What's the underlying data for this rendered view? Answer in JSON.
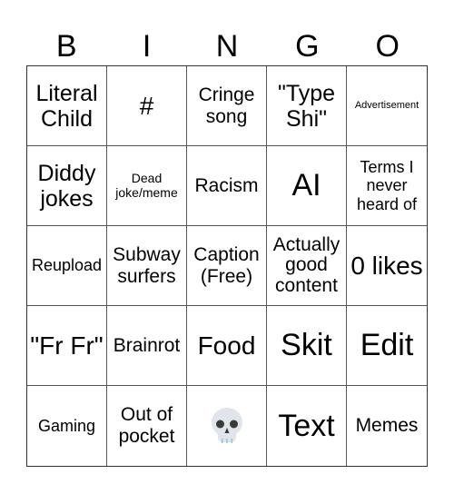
{
  "header": {
    "letters": [
      "B",
      "I",
      "N",
      "G",
      "O"
    ]
  },
  "cells": [
    {
      "text": "Literal Child"
    },
    {
      "text": "#"
    },
    {
      "text": "Cringe song"
    },
    {
      "text": "\"Type Shi\""
    },
    {
      "text": "Advertisement"
    },
    {
      "text": "Diddy jokes"
    },
    {
      "text": "Dead joke/meme"
    },
    {
      "text": "Racism"
    },
    {
      "text": "AI"
    },
    {
      "text": "Terms I never heard of"
    },
    {
      "text": "Reupload"
    },
    {
      "text": "Subway surfers"
    },
    {
      "text": "Caption (Free)"
    },
    {
      "text": "Actually good content"
    },
    {
      "text": "0 likes"
    },
    {
      "text": "\"Fr Fr\""
    },
    {
      "text": "Brainrot"
    },
    {
      "text": "Food"
    },
    {
      "text": "Skit"
    },
    {
      "text": "Edit"
    },
    {
      "text": "Gaming"
    },
    {
      "text": "Out of pocket"
    },
    {
      "icon": "skull-icon"
    },
    {
      "text": "Text"
    },
    {
      "text": "Memes"
    }
  ]
}
